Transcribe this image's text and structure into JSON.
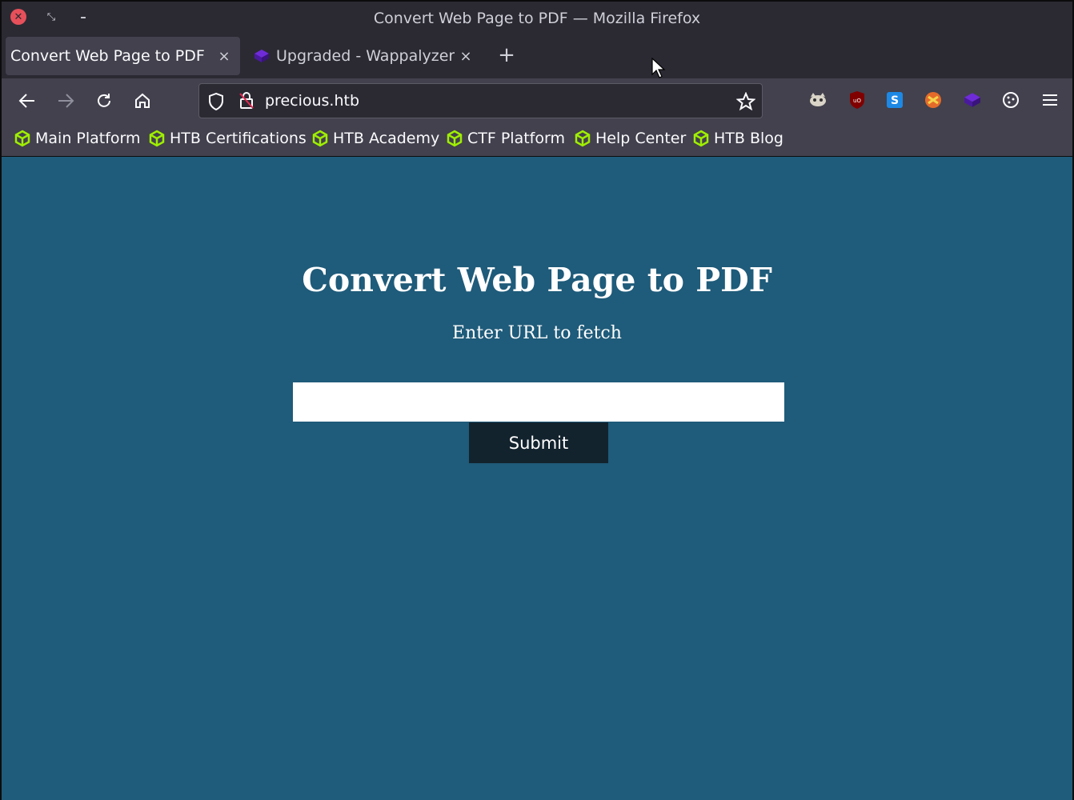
{
  "window": {
    "title": "Convert Web Page to PDF — Mozilla Firefox"
  },
  "tabs": [
    {
      "label": "Convert Web Page to PDF",
      "close": "×",
      "active": true
    },
    {
      "label": "Upgraded - Wappalyzer",
      "close": "×",
      "favicon": "wappalyzer-icon"
    }
  ],
  "newtab_label": "+",
  "urlbar": {
    "url": "precious.htb"
  },
  "bookmarks": [
    {
      "label": "Main Platform"
    },
    {
      "label": "HTB Certifications"
    },
    {
      "label": "HTB Academy"
    },
    {
      "label": "CTF Platform"
    },
    {
      "label": "Help Center"
    },
    {
      "label": "HTB Blog"
    }
  ],
  "page": {
    "heading": "Convert Web Page to PDF",
    "subheading": "Enter URL to fetch",
    "url_field_value": "",
    "submit_label": "Submit"
  },
  "colors": {
    "page_bg": "#1f5b7a",
    "button_bg": "#13232e",
    "bookmark_icon": "#9fef00",
    "close_button": "#e7505a"
  }
}
